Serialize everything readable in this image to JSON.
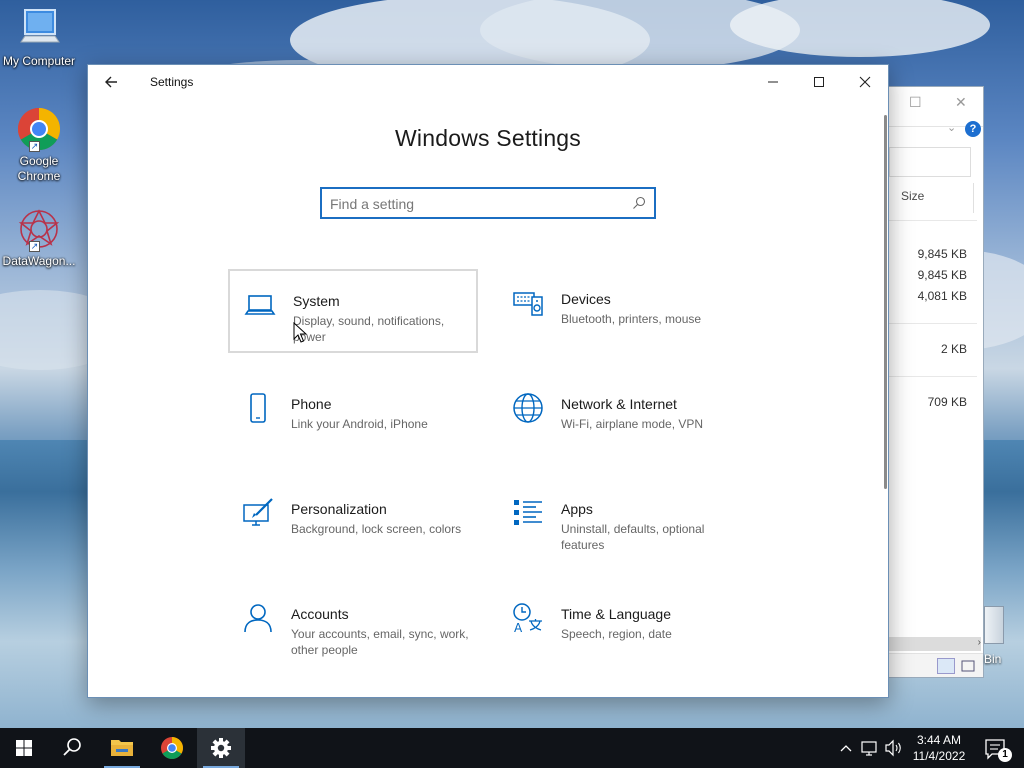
{
  "desktop": {
    "icons": [
      {
        "label": "My Computer"
      },
      {
        "label_line1": "Google",
        "label_line2": "Chrome"
      },
      {
        "label": "DataWagon..."
      }
    ],
    "recycle_label": "Bin"
  },
  "explorer_bg": {
    "size_header": "Size",
    "sizes": [
      "9,845 KB",
      "9,845 KB",
      "4,081 KB",
      "2 KB",
      "709 KB"
    ],
    "help": "?"
  },
  "settings": {
    "window_title": "Settings",
    "heading": "Windows Settings",
    "search_placeholder": "Find a setting",
    "tiles": [
      {
        "title": "System",
        "desc": "Display, sound, notifications, power",
        "icon": "laptop-icon"
      },
      {
        "title": "Devices",
        "desc": "Bluetooth, printers, mouse",
        "icon": "keyboard-speaker-icon"
      },
      {
        "title": "Phone",
        "desc": "Link your Android, iPhone",
        "icon": "phone-icon"
      },
      {
        "title": "Network & Internet",
        "desc": "Wi-Fi, airplane mode, VPN",
        "icon": "globe-icon"
      },
      {
        "title": "Personalization",
        "desc": "Background, lock screen, colors",
        "icon": "paint-icon"
      },
      {
        "title": "Apps",
        "desc": "Uninstall, defaults, optional features",
        "icon": "apps-list-icon"
      },
      {
        "title": "Accounts",
        "desc": "Your accounts, email, sync, work, other people",
        "icon": "person-icon"
      },
      {
        "title": "Time & Language",
        "desc": "Speech, region, date",
        "icon": "time-language-icon"
      }
    ]
  },
  "taskbar": {
    "time": "3:44 AM",
    "date": "11/4/2022",
    "notification_count": "1"
  },
  "colors": {
    "accent": "#0067c0",
    "search_border": "#1b6ec2",
    "taskbar": "#101318"
  }
}
